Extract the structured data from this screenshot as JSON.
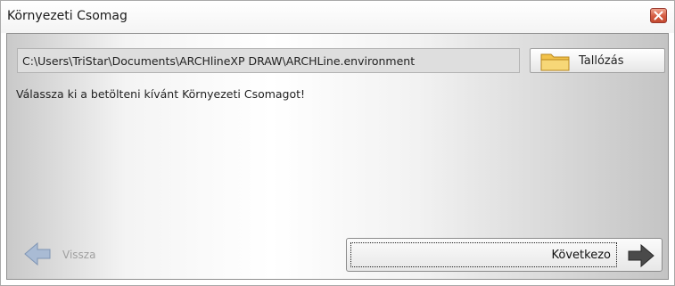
{
  "window": {
    "title": "Környezeti Csomag"
  },
  "path_field": {
    "value": "C:\\Users\\TriStar\\Documents\\ARCHlineXP DRAW\\ARCHLine.environment"
  },
  "browse_button": {
    "label": "Tallózás",
    "icon": "folder-icon"
  },
  "instruction_text": "Válassza ki a betölteni kívánt Környezeti Csomagot!",
  "navigation": {
    "back": {
      "label": "Vissza",
      "enabled": false,
      "icon": "arrow-left-icon"
    },
    "next": {
      "label": "Következo",
      "enabled": true,
      "icon": "arrow-right-icon"
    }
  },
  "colors": {
    "close_button": "#d45a40",
    "folder": "#f2c24a",
    "arrow_disabled": "#8fa5c4",
    "arrow_enabled": "#4a4a4a"
  }
}
